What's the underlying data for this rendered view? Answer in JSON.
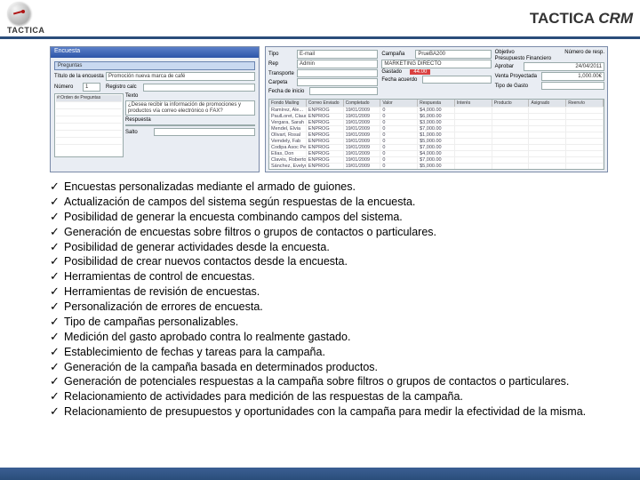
{
  "header": {
    "brand": "TACTICA",
    "title_main": "TACTICA ",
    "title_em": "CRM"
  },
  "mock_left": {
    "titlebar": "Encuesta",
    "section": "Preguntas",
    "label_title": "Título de la encuesta",
    "value_title": "Promoción nueva marca de café",
    "label_num": "Número",
    "value_num": "1",
    "label_field": "Registro calc",
    "value_field": " ",
    "label_q": "Texto",
    "value_q": "¿Desea recibir la información de promociones y productos vía correo electrónico o FAX?",
    "list_hdr": "#:Orden de Preguntas",
    "label_resp": "Respuesta",
    "label_salto": "Salto"
  },
  "mock_right": {
    "labels": {
      "tipo": "Tipo",
      "rep": "Rep",
      "campana": "Campaña",
      "transporte": "Transporte",
      "carpeta": "Carpeta",
      "fecha": "Fecha de inicio",
      "fecha_acuerdo": "Fecha acuerdo",
      "objetivo": "Objetivo",
      "num": "Número de resp.",
      "aprobar": "Aprobar",
      "gastado": "Gastado",
      "venta": "Venta Proyectada",
      "tipogasto": "Tipo de Gasto"
    },
    "values": {
      "tipo": "E-mail",
      "rep": "Admin",
      "campana": "PrueBA200",
      "transporte": "",
      "carpeta": "MARKETING DIRECTO",
      "fecha": "",
      "fecha_acuerdo": "24/04/2011",
      "num": "1,000.00€",
      "objetivo": "",
      "aprobar": "",
      "gastado": "44.00",
      "venta": "",
      "tipogasto": ""
    },
    "grid_headers": [
      "Fondo Mailing",
      "Correo Enviado",
      "Completado",
      "Valor",
      "Respuesta",
      "Interés",
      "Producto",
      "Asignado",
      "Reenvío"
    ],
    "grid_rows": [
      [
        "Ramírez, Ale...",
        "ENPROG",
        "19/01/2009",
        "0",
        "$4,000.00",
        "",
        ""
      ],
      [
        "PaulLoret, Claudia",
        "ENPROG",
        "19/01/2009",
        "0",
        "$6,000.00",
        "",
        ""
      ],
      [
        "Vergara, Sarah",
        "ENPROG",
        "19/01/2009",
        "0",
        "$3,000.00",
        "",
        ""
      ],
      [
        "Mendel, Elvia",
        "ENPROG",
        "19/01/2009",
        "0",
        "$7,000.00",
        "",
        ""
      ],
      [
        "Olivart, Rosal",
        "ENPROG",
        "19/01/2009",
        "0",
        "$1,000.00",
        "",
        ""
      ],
      [
        "Vemdely, Fab",
        "ENPROG",
        "19/01/2009",
        "0",
        "$5,000.00",
        "",
        ""
      ],
      [
        "Codipa Asoc Pepe",
        "ENPROG",
        "19/01/2009",
        "0",
        "$7,000.00",
        "",
        ""
      ],
      [
        "Elías, Don",
        "ENPROG",
        "19/01/2009",
        "0",
        "$4,000.00",
        "",
        ""
      ],
      [
        "Clavés, Roberto",
        "ENPROG",
        "19/01/2009",
        "0",
        "$7,000.00",
        "",
        ""
      ],
      [
        "Sánchez, Evelyna",
        "ENPROG",
        "19/01/2009",
        "0",
        "$5,000.00",
        "",
        ""
      ]
    ]
  },
  "features": [
    "Encuestas personalizadas mediante el armado de guiones.",
    "Actualización de campos del sistema según respuestas de la encuesta.",
    "Posibilidad de generar la encuesta combinando campos del sistema.",
    "Generación de encuestas sobre filtros o grupos de contactos o particulares.",
    "Posibilidad de generar actividades desde la encuesta.",
    "Posibilidad de crear nuevos contactos desde la encuesta.",
    "Herramientas de control de encuestas.",
    "Herramientas de revisión de encuestas.",
    "Personalización de errores de encuesta.",
    "Tipo de campañas personalizables.",
    "Medición del gasto aprobado contra lo realmente gastado.",
    "Establecimiento de fechas y tareas para la campaña.",
    "Generación de la campaña basada en determinados productos.",
    "Generación de potenciales respuestas a la campaña sobre filtros o grupos de contactos o particulares.",
    "Relacionamiento de actividades para medición de las respuestas de la campaña.",
    "Relacionamiento de presupuestos y oportunidades con la campaña para medir la efectividad de la misma."
  ]
}
